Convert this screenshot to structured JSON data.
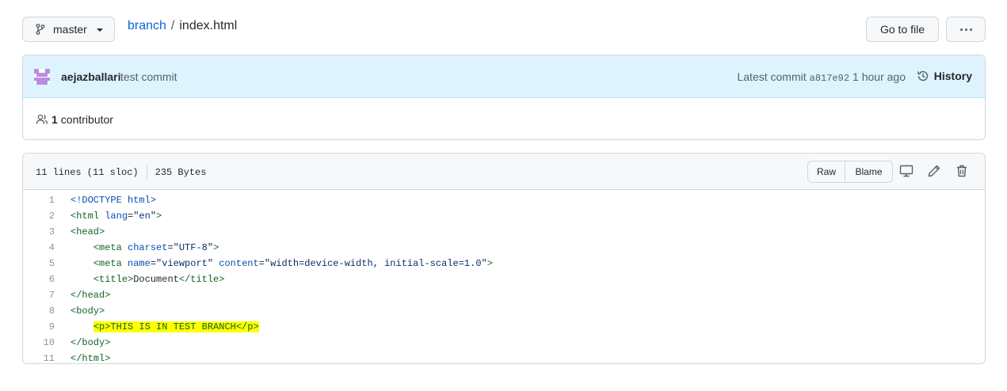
{
  "topbar": {
    "branch_label": "master",
    "repo_link": "branch",
    "separator": "/",
    "file_name": "index.html",
    "goto_label": "Go to file"
  },
  "commit": {
    "author": "aejazballari",
    "message": "test commit",
    "latest_label": "Latest commit",
    "sha": "a817e92",
    "time": "1 hour ago",
    "history_label": "History",
    "contributor_count": "1",
    "contributor_label": "contributor"
  },
  "file": {
    "lines_info": "11 lines (11 sloc)",
    "size": "235 Bytes",
    "raw_label": "Raw",
    "blame_label": "Blame"
  },
  "code": {
    "numbers": [
      "1",
      "2",
      "3",
      "4",
      "5",
      "6",
      "7",
      "8",
      "9",
      "10",
      "11"
    ],
    "l1": "<!DOCTYPE html>",
    "l2_open": "<html",
    "l2_attr": " lang",
    "l2_eq": "=",
    "l2_val": "\"en\"",
    "l2_close": ">",
    "l3": "<head>",
    "l4_open": "<meta",
    "l4_attr": " charset",
    "l4_eq": "=",
    "l4_val": "\"UTF-8\"",
    "l4_close": ">",
    "l5_open": "<meta",
    "l5_attr1": " name",
    "l5_eq1": "=",
    "l5_val1": "\"viewport\"",
    "l5_attr2": " content",
    "l5_eq2": "=",
    "l5_val2": "\"width=device-width, initial-scale=1.0\"",
    "l5_close": ">",
    "l6_open": "<title>",
    "l6_text": "Document",
    "l6_close": "</title>",
    "l7": "</head>",
    "l8": "<body>",
    "l9": "<p>THIS IS IN TEST BRANCH</p>",
    "l10": "</body>",
    "l11": "</html>"
  },
  "colors": {
    "accent": "#0969da",
    "commit_bg": "#ddf4ff",
    "highlight": "#ffff00",
    "avatar": "#b78ee0"
  },
  "icons": [
    "branch-icon",
    "people-icon",
    "history-icon",
    "desktop-icon",
    "pencil-icon",
    "trash-icon",
    "kebab-icon"
  ]
}
